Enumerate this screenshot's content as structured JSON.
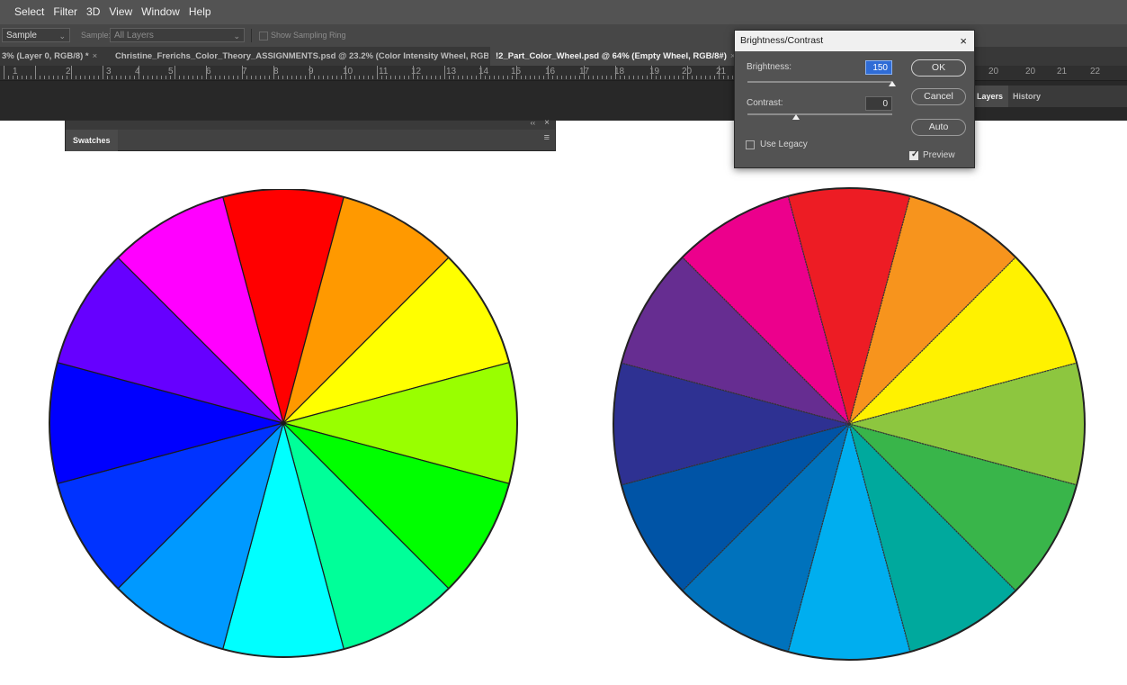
{
  "menu": {
    "items": [
      "Select",
      "Filter",
      "3D",
      "View",
      "Window",
      "Help"
    ]
  },
  "options": {
    "sample_tool_value": "Sample",
    "sample_label": "Sample:",
    "sample_value": "All Layers",
    "sampling_ring_label": "Show Sampling Ring"
  },
  "tabs": [
    {
      "label": "3% (Layer 0, RGB/8) *",
      "close": "×"
    },
    {
      "label": "Christine_Frerichs_Color_Theory_ASSIGNMENTS.psd @ 23.2% (Color Intensity Wheel, RGB/8)",
      "close": "×"
    },
    {
      "label": "!2_Part_Color_Wheel.psd @ 64% (Empty Wheel, RGB/8#)",
      "close": "×"
    }
  ],
  "ruler": {
    "left_numbers": [
      "1",
      "2",
      "3",
      "4",
      "5",
      "6",
      "7",
      "8",
      "9",
      "10",
      "11",
      "12",
      "13",
      "14",
      "15",
      "16",
      "17",
      "18",
      "19",
      "20",
      "21"
    ],
    "right_numbers": [
      "20",
      "20",
      "21",
      "22"
    ]
  },
  "right_panel": {
    "tabs": [
      "Layers",
      "History"
    ]
  },
  "swatches_panel": {
    "tab_label": "Swatches",
    "collapse": "‹‹",
    "close": "×",
    "menu": "≡"
  },
  "dialog": {
    "title": "Brightness/Contrast",
    "close": "×",
    "brightness_label": "Brightness:",
    "brightness_value": "150",
    "brightness_level": 150,
    "contrast_label": "Contrast:",
    "contrast_value": "0",
    "contrast_level": 0,
    "ok_label": "OK",
    "cancel_label": "Cancel",
    "auto_label": "Auto",
    "use_legacy_label": "Use Legacy",
    "use_legacy_checked": false,
    "preview_label": "Preview",
    "preview_checked": true
  },
  "wheels": {
    "left_colors": [
      "#ff0000",
      "#ff9900",
      "#ffff00",
      "#99ff00",
      "#00ff00",
      "#00ff99",
      "#00ffff",
      "#0099ff",
      "#0033ff",
      "#0000ff",
      "#6600ff",
      "#ff00ff"
    ],
    "right_colors": [
      "#ed1c24",
      "#f7941d",
      "#fff200",
      "#8dc63f",
      "#39b54a",
      "#00a99d",
      "#00aeef",
      "#0072bc",
      "#0054a6",
      "#2e3192",
      "#662d91",
      "#ec008c"
    ]
  },
  "colors": {
    "menubar_bg": "#535353",
    "dialog_bg": "#535353",
    "focus_blue": "#2f6cd6"
  }
}
